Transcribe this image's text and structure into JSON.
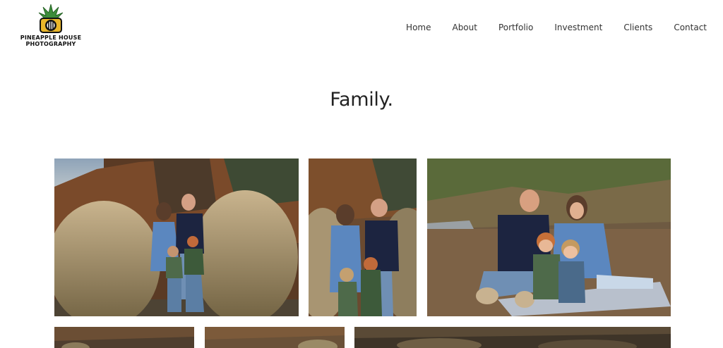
{
  "brand": {
    "line1": "PINEAPPLE HOUSE",
    "line2": "PHOTOGRAPHY",
    "colors": {
      "pineapple_body": "#e9b62a",
      "pineapple_leaves": "#3c8c3a",
      "outline": "#111111"
    }
  },
  "nav": {
    "items": [
      {
        "label": "Home"
      },
      {
        "label": "About"
      },
      {
        "label": "Portfolio"
      },
      {
        "label": "Investment"
      },
      {
        "label": "Clients"
      },
      {
        "label": "Contact"
      }
    ]
  },
  "main": {
    "title": "Family."
  },
  "gallery": {
    "photos": [
      {
        "name": "family-standing-grasses",
        "subject": "family of four standing between tall ornamental grasses"
      },
      {
        "name": "parents-with-boys",
        "subject": "parents smiling with two boys in front of grasses"
      },
      {
        "name": "family-sitting-leaves",
        "subject": "family sitting on blanket in autumn leaves"
      },
      {
        "name": "partial-photo-1",
        "subject": "cropped photo"
      },
      {
        "name": "partial-photo-2",
        "subject": "cropped photo"
      },
      {
        "name": "partial-photo-3",
        "subject": "cropped photo"
      }
    ]
  }
}
